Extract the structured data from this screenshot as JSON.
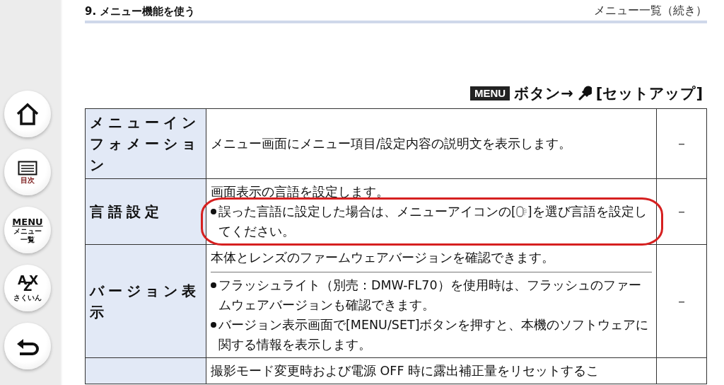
{
  "sidebar": {
    "buttons": [
      {
        "kind": "home"
      },
      {
        "kind": "contents",
        "label": "目次"
      },
      {
        "kind": "menu",
        "label": "MENU",
        "lines": [
          "メニュー",
          "一覧"
        ]
      },
      {
        "kind": "index",
        "letters": [
          "A",
          "Z",
          "X"
        ],
        "label": "さくいん"
      },
      {
        "kind": "back"
      }
    ]
  },
  "header": {
    "section": "9. メニュー機能を使う",
    "title": "メニュー一覧（続き）"
  },
  "path": {
    "badge": "MENU",
    "text": "ボタン→",
    "target": "[セットアップ]"
  },
  "table": {
    "rows": [
      {
        "name": "メニューインフォメーション",
        "intro": "メニュー画面にメニュー項目/設定内容の説明文を表示します。",
        "divided": false,
        "circled": false,
        "bullets": [],
        "value": "－"
      },
      {
        "name": "言語設定",
        "intro": "画面表示の言語を設定します。",
        "divided": false,
        "circled": true,
        "bullets": [
          {
            "kind": "icon",
            "before": "誤った言語に設定した場合は、メニューアイコンの[",
            "after": "]を選び言語を設定してください。"
          }
        ],
        "value": "－"
      },
      {
        "name": "バージョン表示",
        "intro": "本体とレンズのファームウェアバージョンを確認できます。",
        "divided": true,
        "circled": false,
        "bullets": [
          {
            "kind": "text",
            "text": "フラッシュライト（別売：DMW-FL70）を使用時は、フラッシュのファームウェアバージョンも確認できます。"
          },
          {
            "kind": "text",
            "text": "バージョン表示画面で[MENU/SET]ボタンを押すと、本機のソフトウェアに関する情報を表示します。"
          }
        ],
        "value": "－"
      },
      {
        "intro": "撮影モード変更時および電源 OFF 時に露出補正量をリセットするこ",
        "divided": false,
        "circled": false,
        "bullets": []
      }
    ]
  }
}
